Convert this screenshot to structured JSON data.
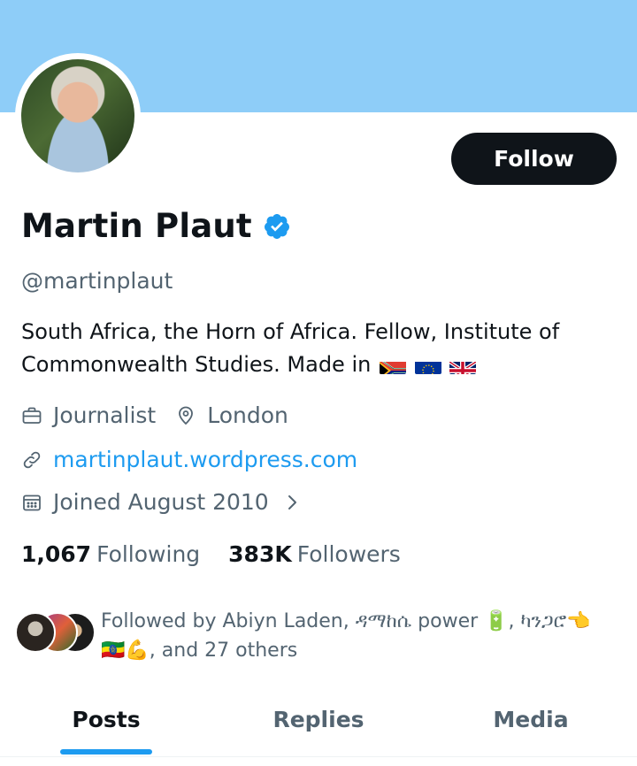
{
  "profile": {
    "name": "Martin Plaut",
    "handle": "@martinplaut",
    "bio": "South Africa, the Horn of Africa. Fellow, Institute of Commonwealth Studies. Made in",
    "bio_flags": [
      "south-africa-flag",
      "eu-flag",
      "uk-flag"
    ],
    "profession": "Journalist",
    "location": "London",
    "website": "martinplaut.wordpress.com",
    "joined": "Joined August 2010"
  },
  "actions": {
    "follow_label": "Follow"
  },
  "stats": {
    "following_count": "1,067",
    "following_label": "Following",
    "followers_count": "383K",
    "followers_label": "Followers"
  },
  "followed_by": {
    "text": "Followed by Abiyn Laden, ዳማከሴ power 🔋, ካንጋሮ👈🇪🇹💪, and 27 others"
  },
  "tabs": [
    {
      "label": "Posts",
      "active": true
    },
    {
      "label": "Replies",
      "active": false
    },
    {
      "label": "Media",
      "active": false
    }
  ],
  "colors": {
    "banner": "#8ecdf8",
    "accent": "#1d9bf0",
    "text_primary": "#0f1419",
    "text_secondary": "#536471"
  }
}
